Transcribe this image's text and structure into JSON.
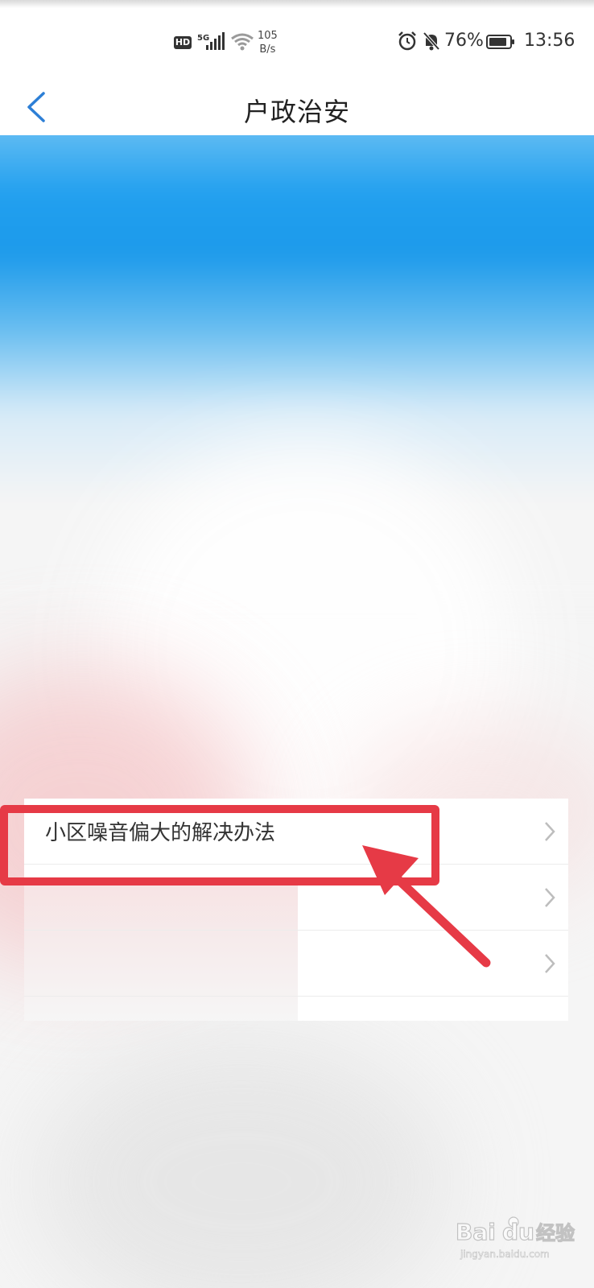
{
  "status_bar": {
    "hd": "HD",
    "network_type": "5G",
    "speed_value": "105",
    "speed_unit": "B/s",
    "battery_percent": "76%",
    "time": "13:56",
    "icons": [
      "hd-icon",
      "signal-icon",
      "wifi-icon",
      "alarm-icon",
      "mute-icon",
      "battery-icon"
    ]
  },
  "nav": {
    "title": "户政治安",
    "back_icon": "chevron-left-icon"
  },
  "list": {
    "items": [
      {
        "label": "小区噪音偏大的解决办法"
      },
      {
        "label": ""
      },
      {
        "label": ""
      }
    ]
  },
  "watermark": {
    "brand": "Baidu 经验",
    "url": "jingyan.baidu.com"
  },
  "colors": {
    "accent_blue": "#1c9aeb",
    "annotation_red": "#e63a46",
    "back_icon": "#2d7fd6"
  }
}
